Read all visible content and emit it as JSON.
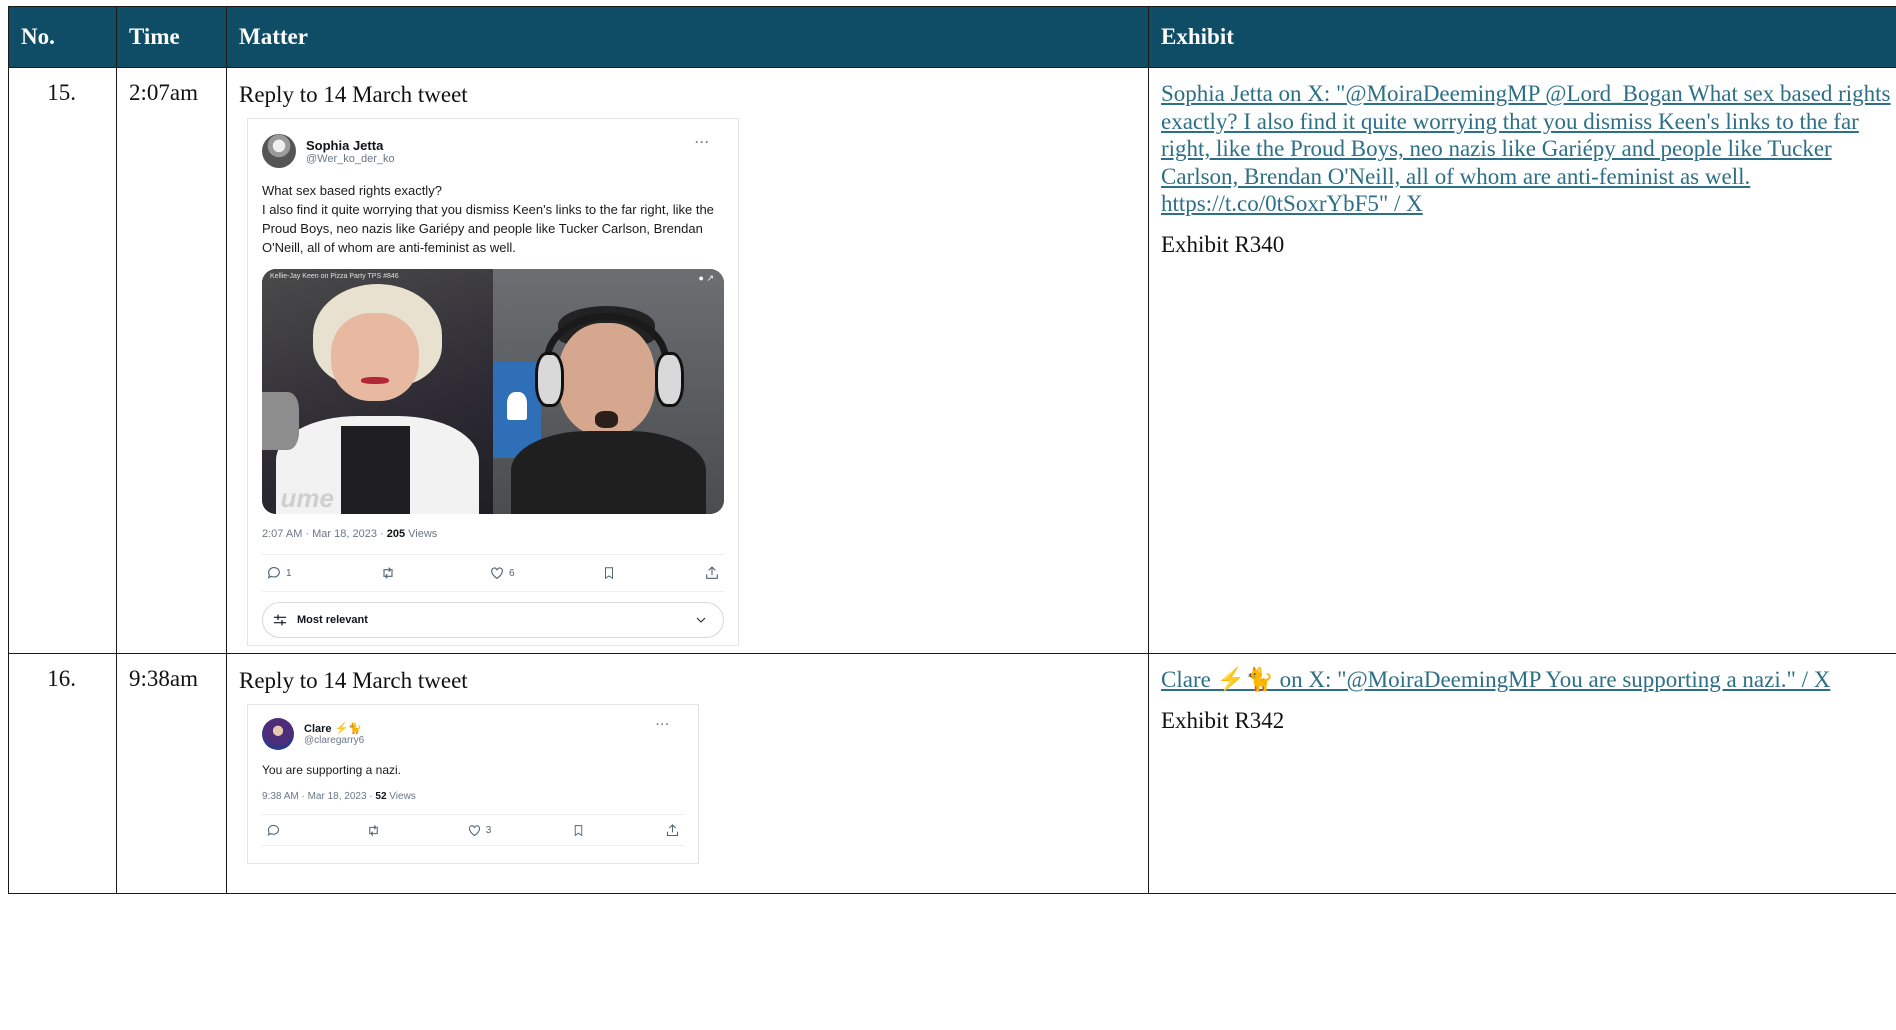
{
  "table": {
    "headers": {
      "no": "No.",
      "time": "Time",
      "matter": "Matter",
      "exhibit": "Exhibit"
    },
    "rows": [
      {
        "no": "15.",
        "time": "2:07am",
        "matter_title": "Reply to 14 March tweet",
        "tweet": {
          "display_name": "Sophia Jetta",
          "handle": "@Wer_ko_der_ko",
          "more": "···",
          "text": "What sex based rights exactly?\nI also find it quite worrying that you dismiss Keen's links to the far right, like the Proud Boys, neo nazis like Gariépy and people like Tucker Carlson, Brendan O'Neill, all of whom are anti-feminist as well.",
          "media_caption": "Kellie-Jay Keen on Pizza Party TPS #846",
          "media_watermark": "ume",
          "timestamp": "2:07 AM · Mar 18, 2023 · ",
          "views_count": "205",
          "views_label": " Views",
          "replies": "1",
          "retweets": "",
          "likes": "6",
          "sort_label": "Most relevant"
        },
        "exhibit_link": "Sophia Jetta on X: \"@MoiraDeemingMP @Lord_Bogan What sex based rights exactly? I also find it quite worrying that you dismiss Keen's links to the far right, like the Proud Boys, neo nazis like Gariépy and people like Tucker Carlson, Brendan O'Neill, all of whom are anti-feminist as well. https://t.co/0tSoxrYbF5\" / X",
        "exhibit_ref": "Exhibit R340"
      },
      {
        "no": "16.",
        "time": "9:38am",
        "matter_title": "Reply to 14 March tweet",
        "tweet": {
          "display_name": "Clare ⚡🐈",
          "handle": "@claregarry6",
          "more": "···",
          "text": "You are supporting a nazi.",
          "timestamp": "9:38 AM · Mar 18, 2023 · ",
          "views_count": "52",
          "views_label": " Views",
          "replies": "",
          "retweets": "",
          "likes": "3"
        },
        "exhibit_link": "Clare ⚡🐈 on X: \"@MoiraDeemingMP You are supporting a nazi.\" / X",
        "exhibit_ref": "Exhibit R342"
      }
    ]
  },
  "colors": {
    "header_bg": "#0f4c66",
    "link": "#2c6f86"
  },
  "icons": [
    "reply-icon",
    "retweet-icon",
    "like-icon",
    "bookmark-icon",
    "share-icon",
    "filter-icon",
    "chevron-down-icon"
  ]
}
